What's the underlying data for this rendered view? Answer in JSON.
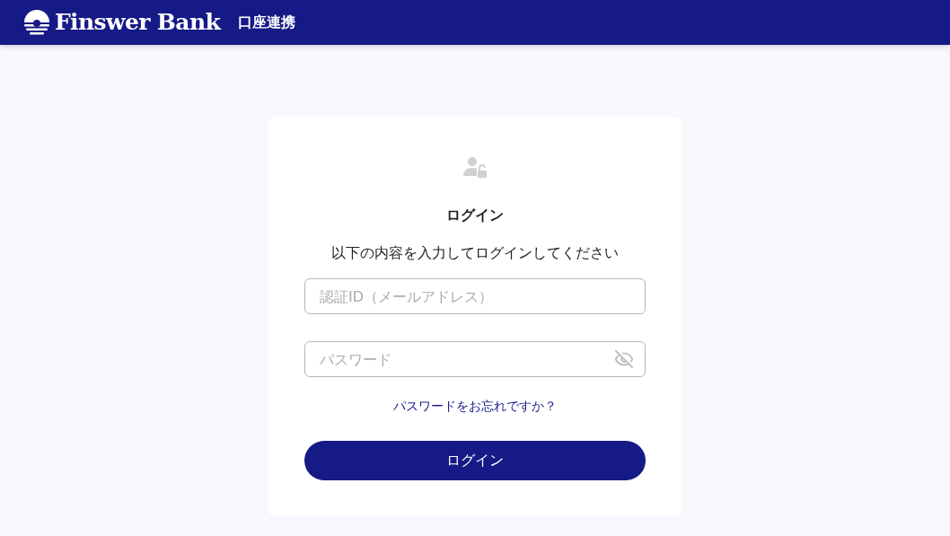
{
  "header": {
    "logo": "Finswer Bank",
    "title": "口座連携"
  },
  "login": {
    "heading": "ログイン",
    "instruction": "以下の内容を入力してログインしてください",
    "id_field": {
      "placeholder": "認証ID（メールアドレス）"
    },
    "password_field": {
      "placeholder": "パスワード"
    },
    "forgot_link": "パスワードをお忘れですか？",
    "submit": "ログイン"
  }
}
